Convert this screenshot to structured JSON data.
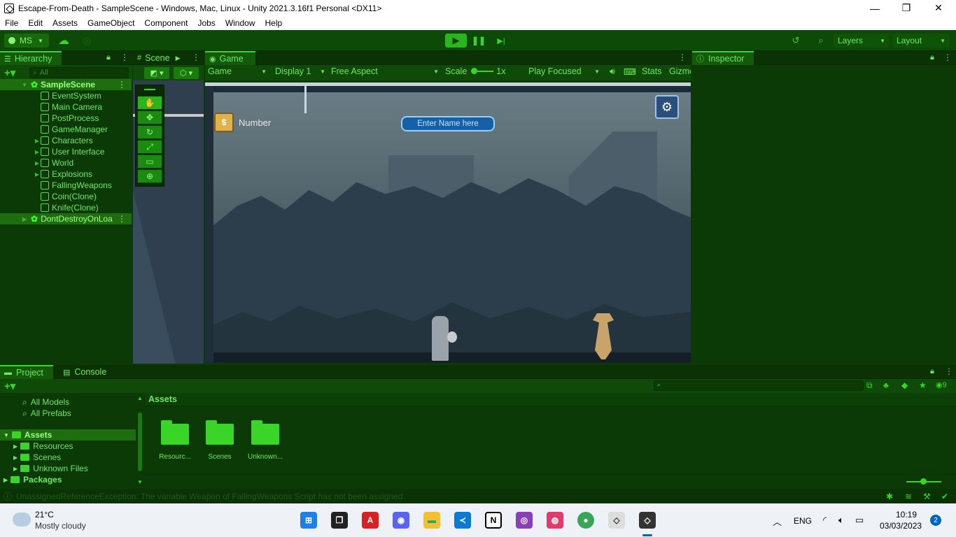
{
  "window": {
    "title": "Escape-From-Death - SampleScene - Windows, Mac, Linux - Unity 2021.3.16f1 Personal <DX11>",
    "minimize": "—",
    "restore": "❐",
    "close": "✕"
  },
  "menu": [
    "File",
    "Edit",
    "Assets",
    "GameObject",
    "Component",
    "Jobs",
    "Window",
    "Help"
  ],
  "toolbar": {
    "account": "MS",
    "layers": "Layers",
    "layout": "Layout"
  },
  "hierarchy": {
    "tab": "Hierarchy",
    "search_placeholder": "All",
    "scene": "SampleScene",
    "items": [
      {
        "label": "EventSystem",
        "expandable": false
      },
      {
        "label": "Main Camera",
        "expandable": false
      },
      {
        "label": "PostProcess",
        "expandable": false
      },
      {
        "label": "GameManager",
        "expandable": false
      },
      {
        "label": "Characters",
        "expandable": true
      },
      {
        "label": "User Interface",
        "expandable": true
      },
      {
        "label": "World",
        "expandable": true
      },
      {
        "label": "Explosions",
        "expandable": true
      },
      {
        "label": "FallingWeapons",
        "expandable": false
      },
      {
        "label": "Coin(Clone)",
        "expandable": false
      },
      {
        "label": "Knife(Clone)",
        "expandable": false
      }
    ],
    "dont_destroy": "DontDestroyOnLoa"
  },
  "scene_tab": {
    "label": "Scene"
  },
  "game": {
    "tab": "Game",
    "display_mode": "Game",
    "display": "Display 1",
    "aspect": "Free Aspect",
    "scale_label": "Scale",
    "scale_value": "1x",
    "play_mode": "Play Focused",
    "stats": "Stats",
    "gizmos": "Gizmo",
    "hud_number": "Number",
    "name_input_placeholder": "Enter Name here"
  },
  "inspector": {
    "tab": "Inspector"
  },
  "project": {
    "tab": "Project",
    "console_tab": "Console",
    "tree": [
      {
        "label": "All Models",
        "type": "search"
      },
      {
        "label": "All Prefabs",
        "type": "search"
      }
    ],
    "assets_root": "Assets",
    "asset_children": [
      "Resources",
      "Scenes",
      "Unknown Files"
    ],
    "packages": "Packages",
    "breadcrumb": "Assets",
    "folders": [
      "Resourc...",
      "Scenes",
      "Unknown..."
    ],
    "hidden_count": "9"
  },
  "status": {
    "message": "UnassignedReferenceException: The variable Weapon of FallingWeapons Script has not been assigned."
  },
  "taskbar": {
    "weather_temp": "21°C",
    "weather_desc": "Mostly cloudy",
    "lang": "ENG",
    "time": "10:19",
    "date": "03/03/2023",
    "notifications": "2"
  }
}
